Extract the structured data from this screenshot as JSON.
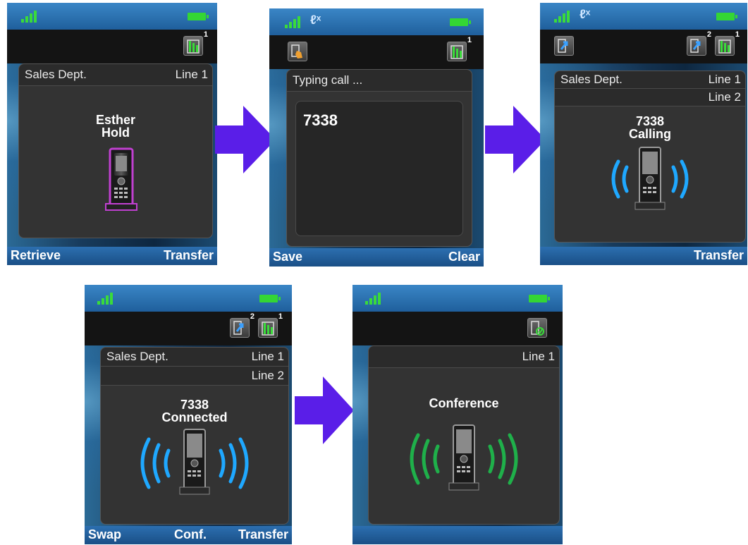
{
  "screens": [
    {
      "softkeys": {
        "left": "Retrieve",
        "right": "Transfer"
      },
      "header": {
        "left": "Sales Dept.",
        "right": "Line 1"
      },
      "call": {
        "name": "Esther",
        "status": "Hold"
      },
      "toolbar_icons": [
        {
          "icon": "line-status-icon",
          "badge": "1"
        }
      ]
    },
    {
      "softkeys": {
        "left": "Save",
        "right": "Clear"
      },
      "header": {
        "left": "Typing call ..."
      },
      "input": {
        "value": "7338"
      },
      "toolbar_icons": [
        {
          "icon": "hand-pointer-icon"
        },
        {
          "icon": "line-status-icon",
          "badge": "1"
        }
      ]
    },
    {
      "softkeys": {
        "right": "Transfer"
      },
      "header": {
        "left": "Sales Dept.",
        "right": "Line 1",
        "right2": "Line 2"
      },
      "call": {
        "name": "7338",
        "status": "Calling"
      },
      "toolbar_icons": [
        {
          "icon": "outgoing-call-icon"
        },
        {
          "icon": "outgoing-call-icon",
          "badge": "2"
        },
        {
          "icon": "line-status-icon",
          "badge": "1"
        }
      ]
    },
    {
      "softkeys": {
        "left": "Swap",
        "mid": "Conf.",
        "right": "Transfer"
      },
      "header": {
        "left": "Sales Dept.",
        "right": "Line 1",
        "right2": "Line 2"
      },
      "call": {
        "name": "7338",
        "status": "Connected"
      },
      "toolbar_icons": [
        {
          "icon": "outgoing-call-icon",
          "badge": "2"
        },
        {
          "icon": "line-status-icon",
          "badge": "1"
        }
      ]
    },
    {
      "header": {
        "right": "Line 1"
      },
      "call": {
        "status": "Conference"
      },
      "toolbar_icons": [
        {
          "icon": "conference-line-icon"
        }
      ]
    }
  ],
  "colors": {
    "signal": "#3adb3a",
    "battery": "#34d634",
    "arrow": "#5a1ee8",
    "hold_phone": "#c040d0",
    "calling_waves": "#1fa8ff",
    "conference_waves": "#1fb04a"
  }
}
